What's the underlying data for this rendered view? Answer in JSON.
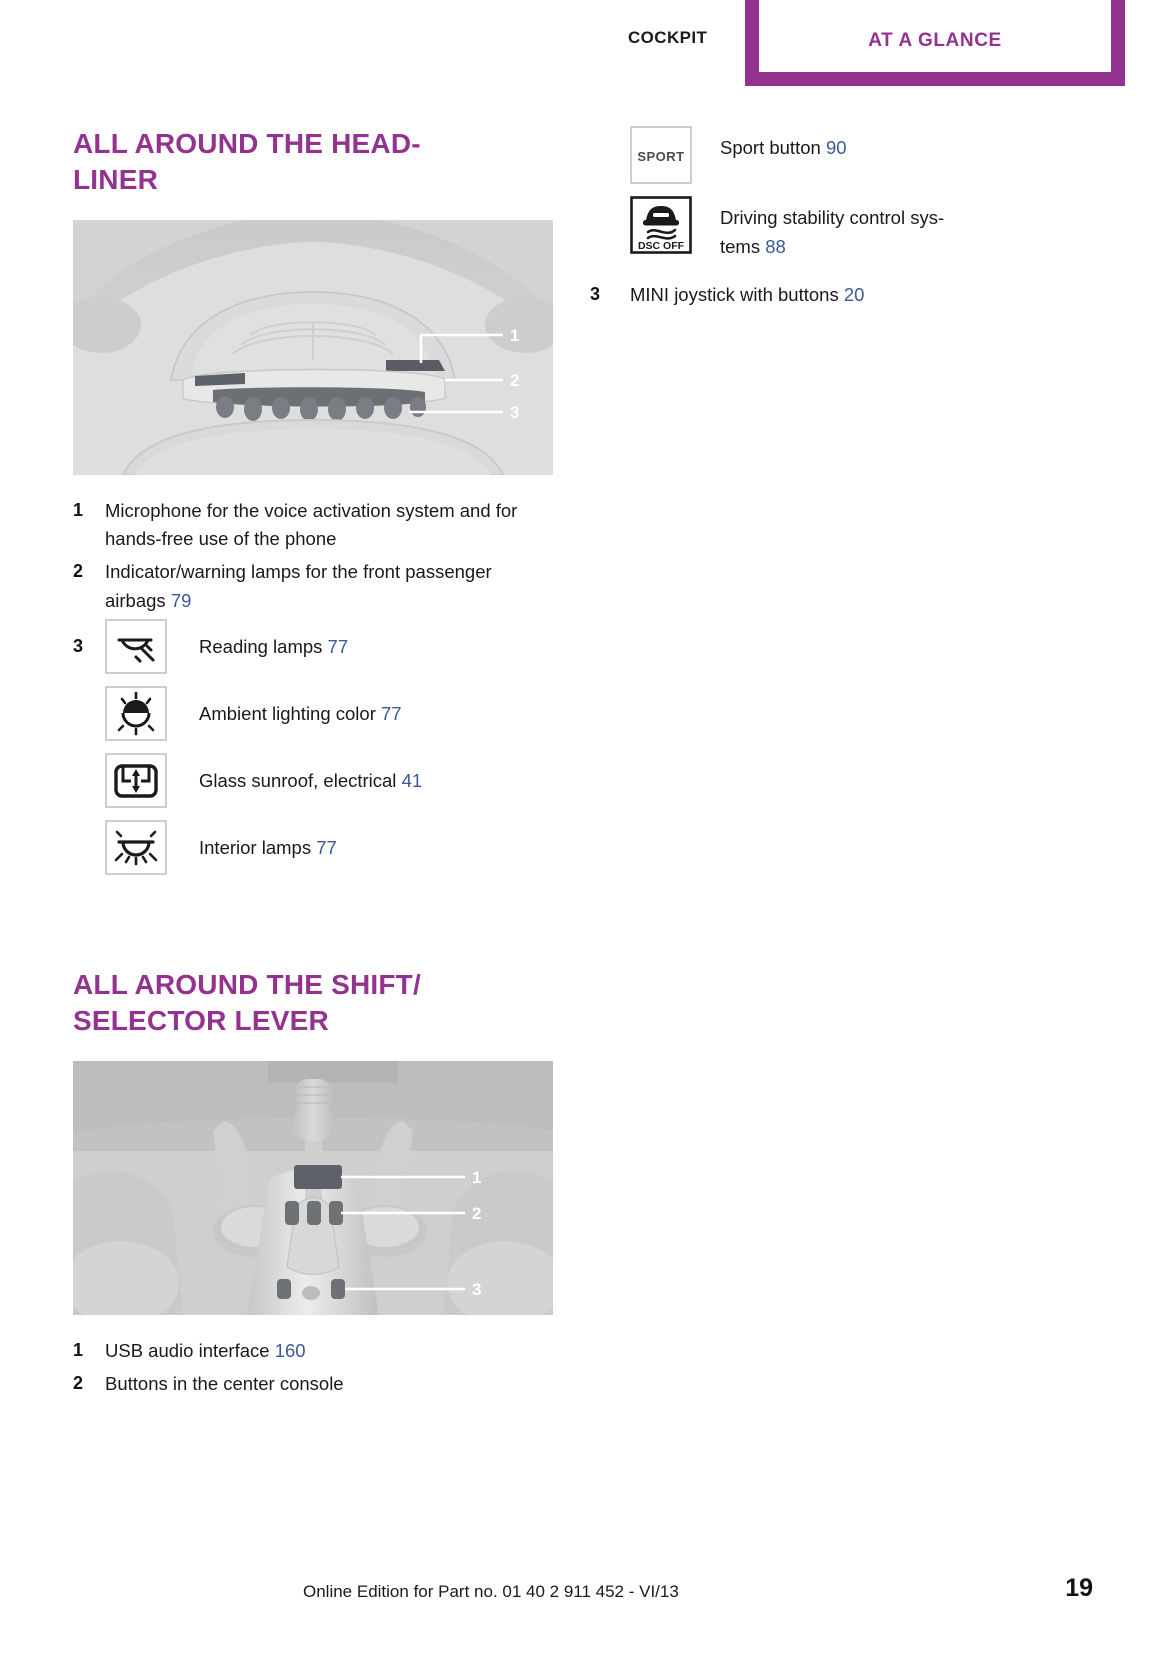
{
  "header": {
    "left_label": "COCKPIT",
    "tab_label": "AT A GLANCE",
    "accent_color": "#93338f"
  },
  "sections": [
    {
      "title": "ALL AROUND THE HEAD-\nLINER",
      "title_line1": "ALL AROUND THE HEAD-",
      "title_line2": "LINER",
      "figure_name": "headliner-overhead-console-illustration",
      "figure_callouts": [
        "1",
        "2",
        "3"
      ],
      "items": [
        {
          "num": "1",
          "text": "Microphone for the voice activation system and for hands-free use of the phone",
          "page": ""
        },
        {
          "num": "2",
          "text": "Indicator/warning lamps for the front passenger airbags",
          "page": "79"
        }
      ],
      "icon_items": [
        {
          "num": "3",
          "icon": "reading-lamp-icon",
          "label": "Reading lamps",
          "page": "77"
        },
        {
          "num": "",
          "icon": "ambient-light-icon",
          "label": "Ambient lighting color",
          "page": "77"
        },
        {
          "num": "",
          "icon": "glass-sunroof-icon",
          "label": "Glass sunroof, electrical",
          "page": "41"
        },
        {
          "num": "",
          "icon": "interior-lamp-icon",
          "label": "Interior lamps",
          "page": "77"
        }
      ]
    },
    {
      "title_line1": "ALL AROUND THE SHIFT/",
      "title_line2": "SELECTOR LEVER",
      "figure_name": "shift-selector-lever-center-console-illustration",
      "figure_callouts": [
        "1",
        "2",
        "3"
      ],
      "items": [
        {
          "num": "1",
          "text": "USB audio interface",
          "page": "160"
        },
        {
          "num": "2",
          "text": "Buttons in the center console",
          "page": ""
        }
      ]
    }
  ],
  "right_column": {
    "icon_items": [
      {
        "icon": "sport-button-icon",
        "icon_text": "SPORT",
        "label": "Sport button",
        "page": "90"
      },
      {
        "icon": "dsc-off-icon",
        "icon_text": "DSC OFF",
        "label": "Driving stability control sys-tems",
        "label_line1": "Driving stability control sys-",
        "label_line2": "tems",
        "page": "88"
      }
    ],
    "items": [
      {
        "num": "3",
        "text": "MINI joystick with buttons",
        "page": "20"
      }
    ]
  },
  "footer": {
    "text": "Online Edition for Part no. 01 40 2 911 452 - VI/13",
    "page_number": "19"
  }
}
